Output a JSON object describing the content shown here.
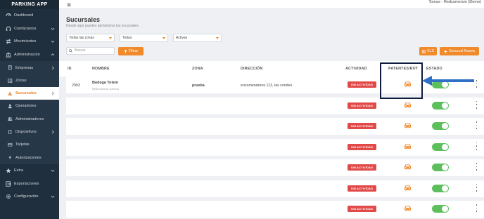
{
  "sidebar": {
    "brand": "PARKING APP",
    "items": [
      {
        "label": "Dashboard",
        "icon": "dashboard-icon"
      },
      {
        "label": "Contáctanos",
        "icon": "headset-icon"
      },
      {
        "label": "Movimientos",
        "icon": "transfer-icon"
      },
      {
        "label": "Administración",
        "icon": "bank-icon"
      },
      {
        "label": "Empresas",
        "icon": "building-icon"
      },
      {
        "label": "Zonas",
        "icon": "grid-icon"
      },
      {
        "label": "Sucursales",
        "icon": "warning-icon"
      },
      {
        "label": "Operadores",
        "icon": "user-icon"
      },
      {
        "label": "Administradores",
        "icon": "users-icon"
      },
      {
        "label": "Dispositivos",
        "icon": "phone-icon"
      },
      {
        "label": "Tarjetas",
        "icon": "card-icon"
      },
      {
        "label": "Autorizaciones",
        "icon": "bolt-icon"
      },
      {
        "label": "Extra",
        "icon": "star-icon"
      },
      {
        "label": "Exportaciones",
        "icon": "export-icon"
      },
      {
        "label": "Configuración",
        "icon": "gear-icon"
      }
    ]
  },
  "topbar": {
    "user": "Tomas - Redcomercio (Demo)"
  },
  "header": {
    "title": "Sucursales",
    "subtitle": "Desde aquí puedes administrar tus sucursales"
  },
  "filters": {
    "zone": "Todas las zonas",
    "type": "Todas",
    "status": "Activas",
    "search_placeholder": "Buscar",
    "filter_button": "Filtrar",
    "xls_button": "XLS",
    "new_button": "Sucursal Nueva"
  },
  "table": {
    "columns": [
      "ID",
      "NOMBRE",
      "ZONA",
      "DIRECCIÓN",
      "ACTIVIDAD",
      "PATENTES/RUT",
      "ESTADO"
    ],
    "rows": [
      {
        "id": "2993",
        "name": "Bodega Totem",
        "company": "Redcomercio (Demo)",
        "zone": "prueba",
        "address": "encomenderos 113, las condes",
        "activity": "SIN ACTIVIDAD",
        "enabled": true
      },
      {
        "id": "",
        "name": "",
        "company": "",
        "zone": "",
        "address": "",
        "activity": "SIN ACTIVIDAD",
        "enabled": true
      },
      {
        "id": "",
        "name": "",
        "company": "",
        "zone": "",
        "address": "",
        "activity": "SIN ACTIVIDAD",
        "enabled": true
      },
      {
        "id": "",
        "name": "",
        "company": "",
        "zone": "",
        "address": "",
        "activity": "SIN ACTIVIDAD",
        "enabled": true
      },
      {
        "id": "",
        "name": "",
        "company": "",
        "zone": "",
        "address": "",
        "activity": "SIN ACTIVIDAD",
        "enabled": true
      },
      {
        "id": "",
        "name": "",
        "company": "",
        "zone": "",
        "address": "",
        "activity": "SIN ACTIVIDAD",
        "enabled": true
      },
      {
        "id": "",
        "name": "",
        "company": "",
        "zone": "",
        "address": "",
        "activity": "SIN ACTIVIDAD",
        "enabled": true
      }
    ]
  },
  "colors": {
    "sidebar_bg": "#1f2f3d",
    "accent": "#f08a2b",
    "badge_red": "#e24a4a",
    "toggle_green": "#5cbf5c",
    "highlight_navy": "#0d1b3e",
    "arrow_blue": "#2f6fc6"
  }
}
